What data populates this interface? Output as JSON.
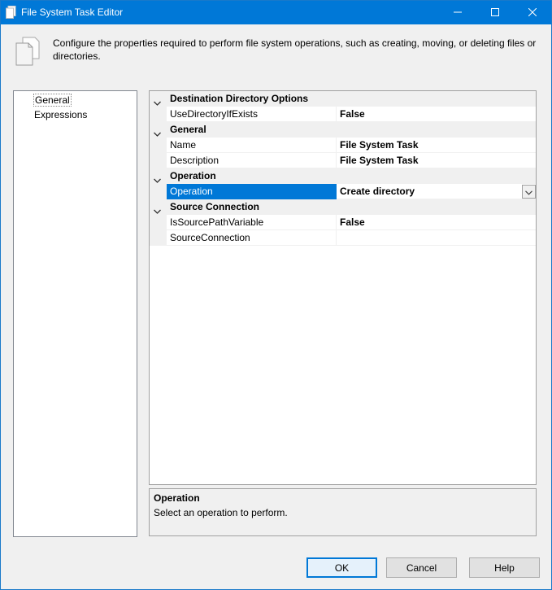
{
  "window": {
    "title": "File System Task Editor"
  },
  "header": {
    "description": "Configure the properties required to perform file system operations, such as creating, moving, or deleting files or directories.",
    "icon": "documents-icon"
  },
  "nav": {
    "items": [
      {
        "label": "General",
        "selected": true
      },
      {
        "label": "Expressions",
        "selected": false
      }
    ]
  },
  "grid": {
    "categories": [
      {
        "label": "Destination Directory Options",
        "properties": [
          {
            "name": "UseDirectoryIfExists",
            "value": "False"
          }
        ]
      },
      {
        "label": "General",
        "properties": [
          {
            "name": "Name",
            "value": "File System Task"
          },
          {
            "name": "Description",
            "value": "File System Task"
          }
        ]
      },
      {
        "label": "Operation",
        "properties": [
          {
            "name": "Operation",
            "value": "Create directory",
            "selected": true
          }
        ]
      },
      {
        "label": "Source Connection",
        "properties": [
          {
            "name": "IsSourcePathVariable",
            "value": "False"
          },
          {
            "name": "SourceConnection",
            "value": ""
          }
        ]
      }
    ]
  },
  "description_panel": {
    "title": "Operation",
    "text": "Select an operation to perform."
  },
  "buttons": {
    "ok": "OK",
    "cancel": "Cancel",
    "help": "Help"
  },
  "colors": {
    "accent": "#0078d7",
    "window_bg": "#f0f0f0"
  }
}
